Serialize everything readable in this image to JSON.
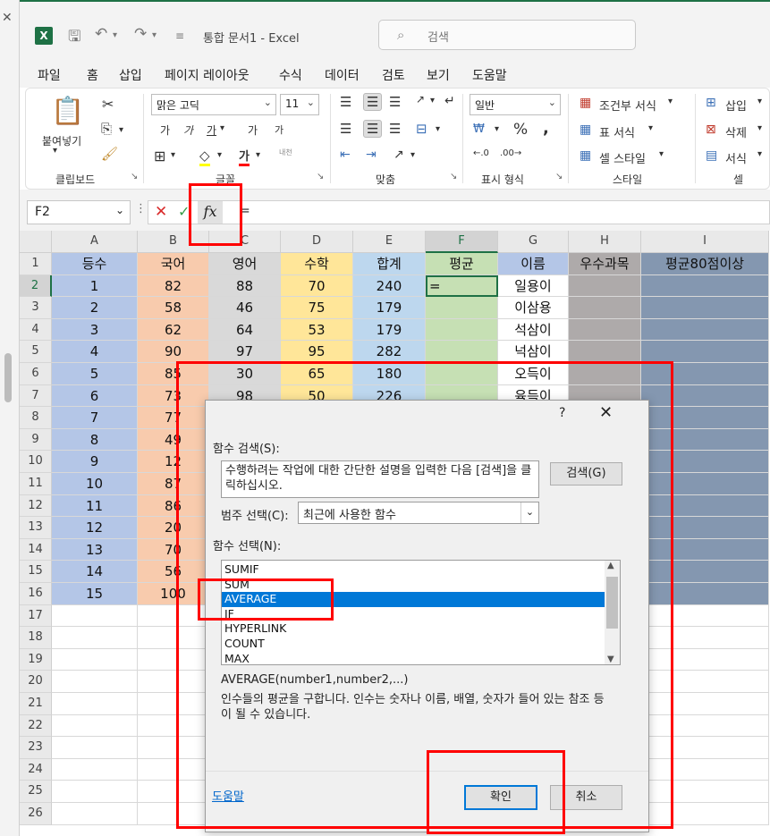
{
  "title_bar": {
    "document_title": "통합 문서1  -  Excel",
    "search_placeholder": "검색"
  },
  "menu": [
    "파일",
    "홈",
    "삽입",
    "페이지 레이아웃",
    "수식",
    "데이터",
    "검토",
    "보기",
    "도움말"
  ],
  "ribbon": {
    "clipboard": {
      "paste": "붙여넣기",
      "label": "클립보드"
    },
    "font": {
      "name": "맑은 고딕",
      "size": "11",
      "label": "글꼴",
      "grow": "가",
      "shrink": "가",
      "bold": "가",
      "italic": "가",
      "underline": "가",
      "font_color_glyph": "가",
      "phonetic": "내천"
    },
    "alignment": {
      "label": "맞춤"
    },
    "number": {
      "format": "일반",
      "label": "표시 형식"
    },
    "styles": {
      "conditional": "조건부 서식",
      "table": "표 서식",
      "cell": "셀 스타일",
      "label": "스타일"
    },
    "cells": {
      "insert": "삽입",
      "delete": "삭제",
      "format": "서식",
      "label": "셀"
    }
  },
  "formula_bar": {
    "name_box": "F2",
    "formula": "="
  },
  "sheet": {
    "columns": [
      "A",
      "B",
      "C",
      "D",
      "E",
      "F",
      "G",
      "H",
      "I"
    ],
    "rows": [
      "1",
      "2",
      "3",
      "4",
      "5",
      "6",
      "7",
      "8",
      "9",
      "10",
      "11",
      "12",
      "13",
      "14",
      "15",
      "16",
      "17",
      "18",
      "19",
      "20",
      "21",
      "22",
      "23",
      "24",
      "25",
      "26"
    ],
    "header_row": [
      "등수",
      "국어",
      "영어",
      "수학",
      "합계",
      "평균",
      "이름",
      "우수과목",
      "평균80점이상"
    ],
    "data": [
      [
        "1",
        "82",
        "88",
        "70",
        "240",
        "=",
        "일용이"
      ],
      [
        "2",
        "58",
        "46",
        "75",
        "179",
        "",
        "이삼용"
      ],
      [
        "3",
        "62",
        "64",
        "53",
        "179",
        "",
        "석삼이"
      ],
      [
        "4",
        "90",
        "97",
        "95",
        "282",
        "",
        "넉삼이"
      ],
      [
        "5",
        "85",
        "30",
        "65",
        "180",
        "",
        "오득이"
      ],
      [
        "6",
        "73",
        "98",
        "50",
        "226",
        "",
        "육득이"
      ],
      [
        "7",
        "77",
        "",
        "",
        "",
        "",
        ""
      ],
      [
        "8",
        "49",
        "",
        "",
        "",
        "",
        ""
      ],
      [
        "9",
        "12",
        "",
        "",
        "",
        "",
        ""
      ],
      [
        "10",
        "87",
        "",
        "",
        "",
        "",
        ""
      ],
      [
        "11",
        "86",
        "",
        "",
        "",
        "",
        ""
      ],
      [
        "12",
        "20",
        "",
        "",
        "",
        "",
        ""
      ],
      [
        "13",
        "70",
        "",
        "",
        "",
        "",
        ""
      ],
      [
        "14",
        "56",
        "",
        "",
        "",
        "",
        ""
      ],
      [
        "15",
        "100",
        "",
        "",
        "",
        "",
        ""
      ]
    ]
  },
  "dialog": {
    "help_glyph": "?",
    "close_glyph": "✕",
    "search_label": "함수 검색(S):",
    "search_text": "수행하려는 작업에 대한 간단한 설명을 입력한 다음 [검색]을 클릭하십시오.",
    "search_button": "검색(G)",
    "category_label": "범주 선택(C):",
    "category_value": "최근에 사용한 함수",
    "function_label": "함수 선택(N):",
    "functions": [
      "SUMIF",
      "SUM",
      "AVERAGE",
      "IF",
      "HYPERLINK",
      "COUNT",
      "MAX"
    ],
    "selected_function": "AVERAGE",
    "signature": "AVERAGE(number1,number2,...)",
    "description": "인수들의 평균을 구합니다. 인수는 숫자나 이름, 배열, 숫자가 들어 있는 참조 등이 될 수 있습니다.",
    "help_link": "도움말",
    "ok_button": "확인",
    "cancel_button": "취소"
  },
  "colors": {
    "excel_green": "#1e7145",
    "rank_fill": "#b4c6e7",
    "korean_fill": "#f8cbad",
    "english_fill": "#d9d9d9",
    "math_fill": "#ffe699",
    "total_fill": "#bdd7ee",
    "average_fill": "#c6e0b4",
    "name_fill": "#ffffff",
    "best_subject_fill": "#aeaaaa",
    "over80_fill": "#8497b0",
    "annotation_red": "#ff0000"
  }
}
